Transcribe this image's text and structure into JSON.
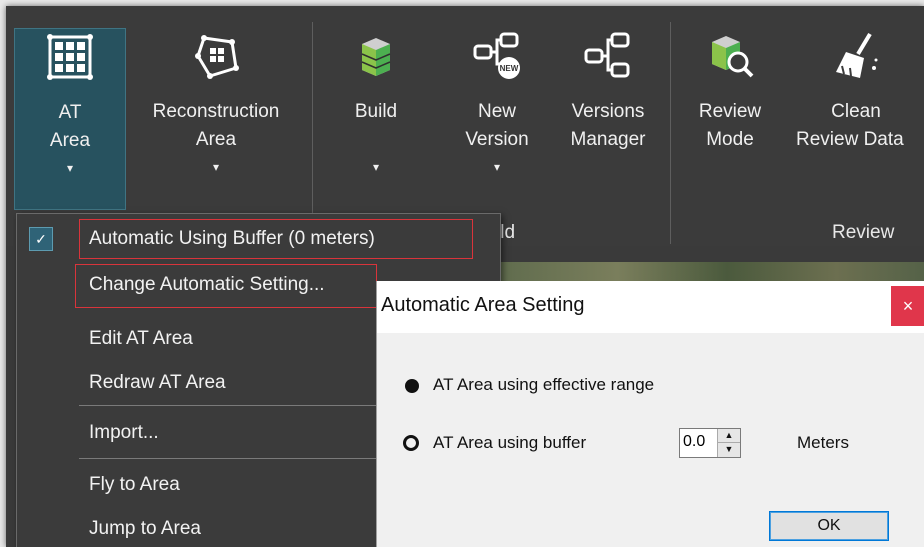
{
  "ribbon": {
    "buttons": [
      {
        "label1": "AT",
        "label2": "Area",
        "icon": "grid-icon"
      },
      {
        "label1": "Reconstruction",
        "label2": "Area",
        "icon": "polygon-area-icon"
      },
      {
        "label1": "Build",
        "label2": "",
        "icon": "build-icon"
      },
      {
        "label1": "New",
        "label2": "Version",
        "icon": "new-version-icon",
        "badge": "NEW"
      },
      {
        "label1": "Versions",
        "label2": "Manager",
        "icon": "versions-manager-icon"
      },
      {
        "label1": "Review",
        "label2": "Mode",
        "icon": "review-mode-icon"
      },
      {
        "label1": "Clean",
        "label2": "Review Data",
        "icon": "broom-icon"
      }
    ],
    "group_build_partial": "ild",
    "group_review": "Review",
    "caret": "▾"
  },
  "menu": {
    "items": [
      "Automatic Using Buffer (0 meters)",
      "Change Automatic Setting...",
      "Edit AT Area",
      "Redraw AT Area",
      "Import...",
      "Fly to Area",
      "Jump to Area"
    ],
    "check_mark": "✓"
  },
  "dialog": {
    "title": "Automatic Area Setting",
    "close": "×",
    "option1": "AT Area using effective range",
    "option2": "AT Area using buffer",
    "buffer_value": "0.0",
    "unit": "Meters",
    "ok": "OK",
    "spin_up": "▲",
    "spin_down": "▼"
  },
  "colors": {
    "ribbon_bg": "#3b3b3b",
    "active_button": "#27525f",
    "highlight_border": "#d9343b",
    "close_button": "#e0364b"
  }
}
